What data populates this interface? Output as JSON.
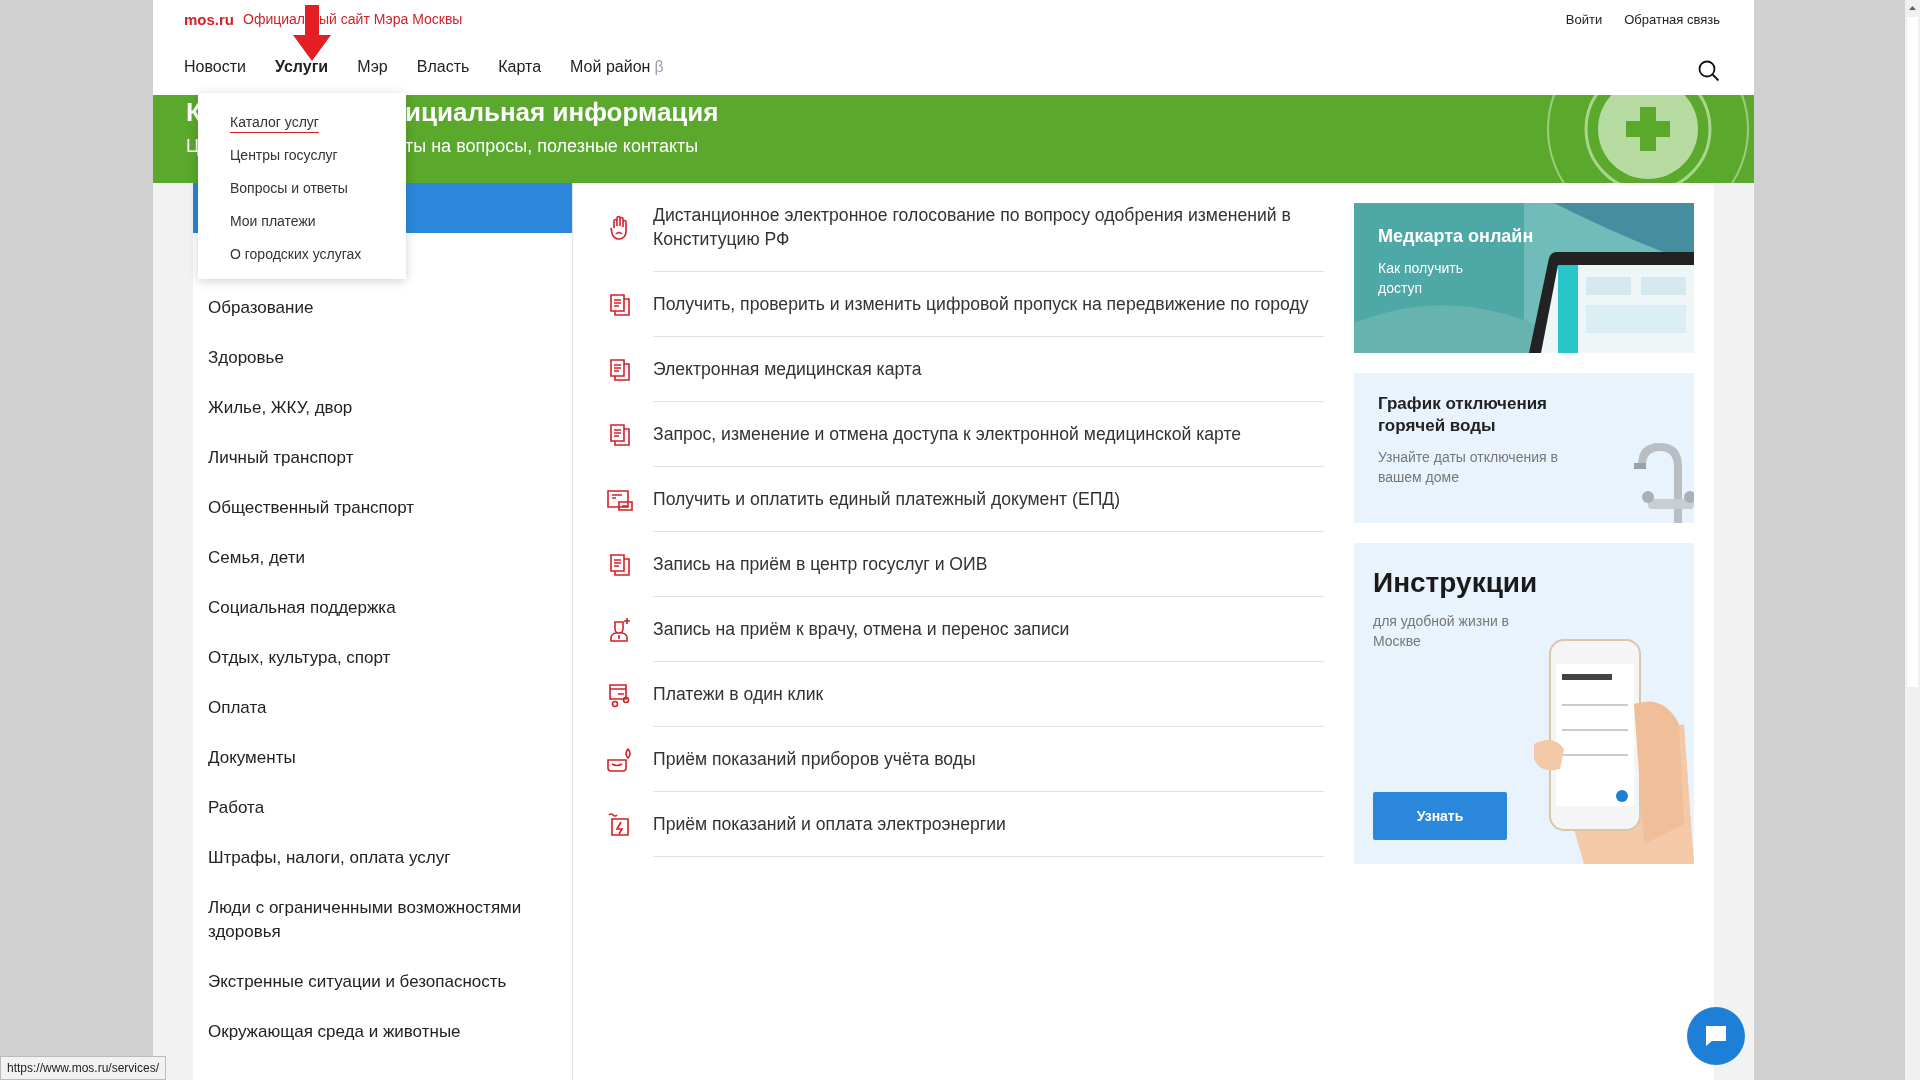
{
  "site": {
    "logo": "mos.ru",
    "tagline_parts": [
      "Официал",
      "ый сайт Мэра Москвы"
    ]
  },
  "top_links": [
    "Войти",
    "Обратная связь"
  ],
  "nav": [
    {
      "label": "Новости",
      "selected": false
    },
    {
      "label": "Услуги",
      "selected": true
    },
    {
      "label": "Мэр",
      "selected": false
    },
    {
      "label": "Власть",
      "selected": false
    },
    {
      "label": "Карта",
      "selected": false
    },
    {
      "label": "Мой район",
      "suffix": "β",
      "selected": false
    }
  ],
  "dropdown": [
    {
      "label": "Каталог услуг",
      "selected": true
    },
    {
      "label": "Центры госуслуг",
      "selected": false
    },
    {
      "label": "Вопросы и ответы",
      "selected": false
    },
    {
      "label": "Мои платежи",
      "selected": false
    },
    {
      "label": "О городских услугах",
      "selected": false
    }
  ],
  "banner": {
    "title_parts": [
      "К",
      "ициальная информация"
    ],
    "subtitle_parts": [
      "Ц",
      "ты на вопросы, полезные контакты"
    ]
  },
  "categories": [
    {
      "selected": true
    },
    {
      "selected": false
    },
    {
      "label": "Образование",
      "selected": false
    },
    {
      "label": "Здоровье",
      "selected": false
    },
    {
      "label": "Жилье, ЖКУ, двор",
      "selected": false
    },
    {
      "label": "Личный транспорт",
      "selected": false
    },
    {
      "label": "Общественный транспорт",
      "selected": false
    },
    {
      "label": "Семья, дети",
      "selected": false
    },
    {
      "label": "Социальная поддержка",
      "selected": false
    },
    {
      "label": "Отдых, культура, спорт",
      "selected": false
    },
    {
      "label": "Оплата",
      "selected": false
    },
    {
      "label": "Документы",
      "selected": false
    },
    {
      "label": "Работа",
      "selected": false
    },
    {
      "label": "Штрафы, налоги, оплата услуг",
      "selected": false
    },
    {
      "label": "Люди с ограниченными возможностями здоровья",
      "selected": false
    },
    {
      "label": "Экстренные ситуации и безопасность",
      "selected": false
    },
    {
      "label": "Окружающая среда и животные",
      "selected": false
    }
  ],
  "services": [
    {
      "kind": "vote",
      "label": "Дистанционное электронное голосование по вопросу одобрения изменений в Конституцию РФ"
    },
    {
      "kind": "document",
      "label": "Получить, проверить и изменить цифровой пропуск на передвижение по городу"
    },
    {
      "kind": "document",
      "label": "Электронная медицинская карта"
    },
    {
      "kind": "document",
      "label": "Запрос, изменение и отмена доступа к электронной медицинской карте"
    },
    {
      "kind": "bill",
      "label": "Получить и оплатить единый платежный документ (ЕПД)"
    },
    {
      "kind": "document",
      "label": "Запись на приём в центр госуслуг и ОИВ"
    },
    {
      "kind": "doctor",
      "label": "Запись на приём к врачу, отмена и перенос записи"
    },
    {
      "kind": "payment",
      "label": "Платежи в один клик"
    },
    {
      "kind": "water",
      "label": "Приём показаний приборов учёта воды"
    },
    {
      "kind": "power",
      "label": "Приём показаний и оплата электроэнергии"
    }
  ],
  "promos": [
    {
      "kind": "medcard",
      "title": "Медкарта онлайн",
      "subtitle": "Как получить доступ"
    },
    {
      "kind": "water",
      "title": "График отключения горячей воды",
      "subtitle": "Узнайте даты отключения в вашем доме"
    },
    {
      "kind": "instructions",
      "title": "Инструкции",
      "subtitle": "для удобной жизни в Москве",
      "button": "Узнать"
    }
  ],
  "status_url": "https://www.mos.ru/services/"
}
